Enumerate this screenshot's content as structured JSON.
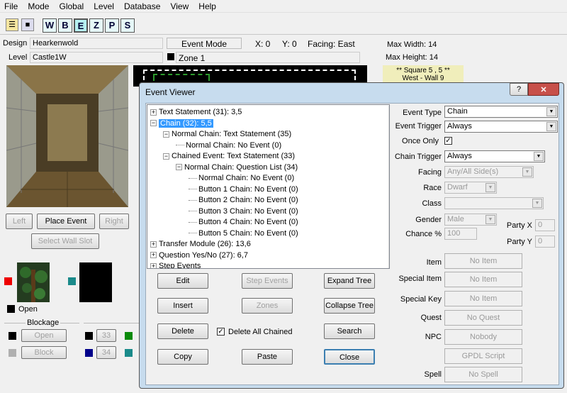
{
  "menu": [
    "File",
    "Mode",
    "Global",
    "Level",
    "Database",
    "View",
    "Help"
  ],
  "toolbar": {
    "letters": [
      "W",
      "B",
      "E",
      "Z",
      "P",
      "S"
    ]
  },
  "header": {
    "design_label": "Design",
    "design_value": "Hearkenwold",
    "level_label": "Level",
    "level_value": "Castle1W",
    "mode": "Event Mode",
    "x": "X: 0",
    "y": "Y: 0",
    "facing": "Facing: East",
    "zone": "Zone 1",
    "max_width": "Max Width: 14",
    "max_height": "Max Height: 14",
    "square": "** Square 5 , 5 **",
    "wall": "West - Wall 9"
  },
  "left_panel": {
    "left": "Left",
    "place_event": "Place Event",
    "right": "Right",
    "select_wall_slot": "Select Wall Slot",
    "open": "Open",
    "blockage": "Blockage",
    "open_btn": "Open",
    "block_btn": "Block",
    "n33": "33",
    "n34": "34"
  },
  "dialog": {
    "title": "Event Viewer",
    "help": "?",
    "close": "✕",
    "tree": [
      {
        "indent": 0,
        "exp": "+",
        "text": "Text Statement (31): 3,5"
      },
      {
        "indent": 0,
        "exp": "-",
        "text": "Chain (32): 5,5",
        "selected": true
      },
      {
        "indent": 1,
        "exp": "-",
        "text": "Normal Chain: Text Statement (35)"
      },
      {
        "indent": 2,
        "exp": "",
        "text": "Normal Chain: No Event (0)"
      },
      {
        "indent": 1,
        "exp": "-",
        "text": "Chained Event: Text Statement (33)"
      },
      {
        "indent": 2,
        "exp": "-",
        "text": "Normal Chain: Question List (34)"
      },
      {
        "indent": 3,
        "exp": "",
        "text": "Normal Chain: No Event (0)"
      },
      {
        "indent": 3,
        "exp": "",
        "text": "Button 1 Chain: No Event (0)"
      },
      {
        "indent": 3,
        "exp": "",
        "text": "Button 2 Chain: No Event (0)"
      },
      {
        "indent": 3,
        "exp": "",
        "text": "Button 3 Chain: No Event (0)"
      },
      {
        "indent": 3,
        "exp": "",
        "text": "Button 4 Chain: No Event (0)"
      },
      {
        "indent": 3,
        "exp": "",
        "text": "Button 5 Chain: No Event (0)"
      },
      {
        "indent": 0,
        "exp": "+",
        "text": "Transfer Module (26): 13,6"
      },
      {
        "indent": 0,
        "exp": "+",
        "text": "Question Yes/No (27): 6,7"
      },
      {
        "indent": 0,
        "exp": "+",
        "text": "Step Events"
      }
    ],
    "buttons": {
      "edit": "Edit",
      "step_events": "Step Events",
      "expand_tree": "Expand Tree",
      "insert": "Insert",
      "zones": "Zones",
      "collapse_tree": "Collapse Tree",
      "delete": "Delete",
      "delete_all_chained": "Delete All Chained",
      "search": "Search",
      "copy": "Copy",
      "paste": "Paste",
      "close": "Close"
    },
    "props": {
      "event_type_label": "Event Type",
      "event_type": "Chain",
      "event_trigger_label": "Event Trigger",
      "event_trigger": "Always",
      "once_only_label": "Once Only",
      "chain_trigger_label": "Chain Trigger",
      "chain_trigger": "Always",
      "facing_label": "Facing",
      "facing": "Any/All Side(s)",
      "race_label": "Race",
      "race": "Dwarf",
      "class_label": "Class",
      "class": "",
      "gender_label": "Gender",
      "gender": "Male",
      "chance_label": "Chance %",
      "chance": "100",
      "party_x_label": "Party X",
      "party_x": "0",
      "party_y_label": "Party Y",
      "party_y": "0",
      "item_label": "Item",
      "item": "No Item",
      "special_item_label": "Special Item",
      "special_item": "No Item",
      "special_key_label": "Special Key",
      "special_key": "No Item",
      "quest_label": "Quest",
      "quest": "No Quest",
      "npc_label": "NPC",
      "npc": "Nobody",
      "gpdl": "GPDL Script",
      "spell_label": "Spell",
      "spell": "No Spell"
    }
  }
}
